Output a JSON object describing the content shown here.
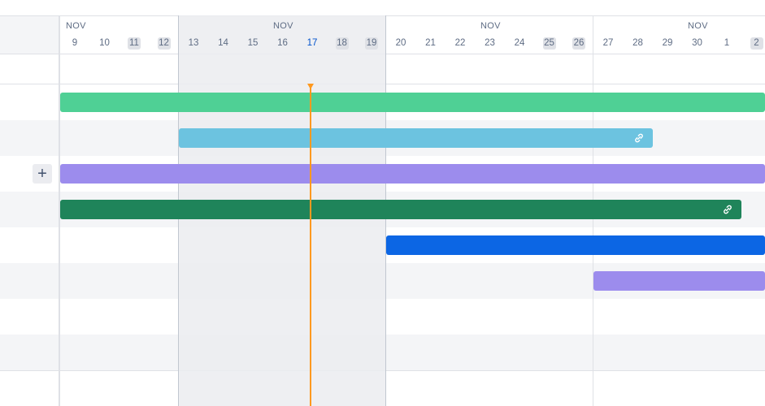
{
  "colors": {
    "green_light": "#4fd095",
    "blue_light": "#6cc3e0",
    "purple": "#9c8ced",
    "green_dark": "#1f845a",
    "blue": "#0c66e4",
    "today": "#ff991f"
  },
  "header": {
    "months": [
      "NOV",
      "NOV",
      "NOV",
      "NOV"
    ],
    "days": [
      {
        "label": "9",
        "weekend": false,
        "today": false
      },
      {
        "label": "10",
        "weekend": false,
        "today": false
      },
      {
        "label": "11",
        "weekend": true,
        "today": false
      },
      {
        "label": "12",
        "weekend": true,
        "today": false
      },
      {
        "label": "13",
        "weekend": false,
        "today": false
      },
      {
        "label": "14",
        "weekend": false,
        "today": false
      },
      {
        "label": "15",
        "weekend": false,
        "today": false
      },
      {
        "label": "16",
        "weekend": false,
        "today": false
      },
      {
        "label": "17",
        "weekend": false,
        "today": true
      },
      {
        "label": "18",
        "weekend": true,
        "today": false
      },
      {
        "label": "19",
        "weekend": true,
        "today": false
      },
      {
        "label": "20",
        "weekend": false,
        "today": false
      },
      {
        "label": "21",
        "weekend": false,
        "today": false
      },
      {
        "label": "22",
        "weekend": false,
        "today": false
      },
      {
        "label": "23",
        "weekend": false,
        "today": false
      },
      {
        "label": "24",
        "weekend": false,
        "today": false
      },
      {
        "label": "25",
        "weekend": true,
        "today": false
      },
      {
        "label": "26",
        "weekend": true,
        "today": false
      },
      {
        "label": "27",
        "weekend": false,
        "today": false
      },
      {
        "label": "28",
        "weekend": false,
        "today": false
      },
      {
        "label": "29",
        "weekend": false,
        "today": false
      },
      {
        "label": "30",
        "weekend": false,
        "today": false
      },
      {
        "label": "1",
        "weekend": false,
        "today": false
      },
      {
        "label": "2",
        "weekend": true,
        "today": false
      }
    ]
  },
  "add_button": {
    "label": "+",
    "icon": "plus-icon"
  },
  "bars": [
    {
      "color_key": "green_light",
      "start_day": "9",
      "end_day": "2",
      "has_link": false
    },
    {
      "color_key": "blue_light",
      "start_day": "13",
      "end_day": "28",
      "has_link": true
    },
    {
      "color_key": "purple",
      "start_day": "9",
      "end_day": "2",
      "has_link": false
    },
    {
      "color_key": "green_dark",
      "start_day": "9",
      "end_day": "1",
      "has_link": true
    },
    {
      "color_key": "blue",
      "start_day": "20",
      "end_day": "2",
      "has_link": false
    },
    {
      "color_key": "purple",
      "start_day": "27",
      "end_day": "2",
      "has_link": false
    }
  ]
}
